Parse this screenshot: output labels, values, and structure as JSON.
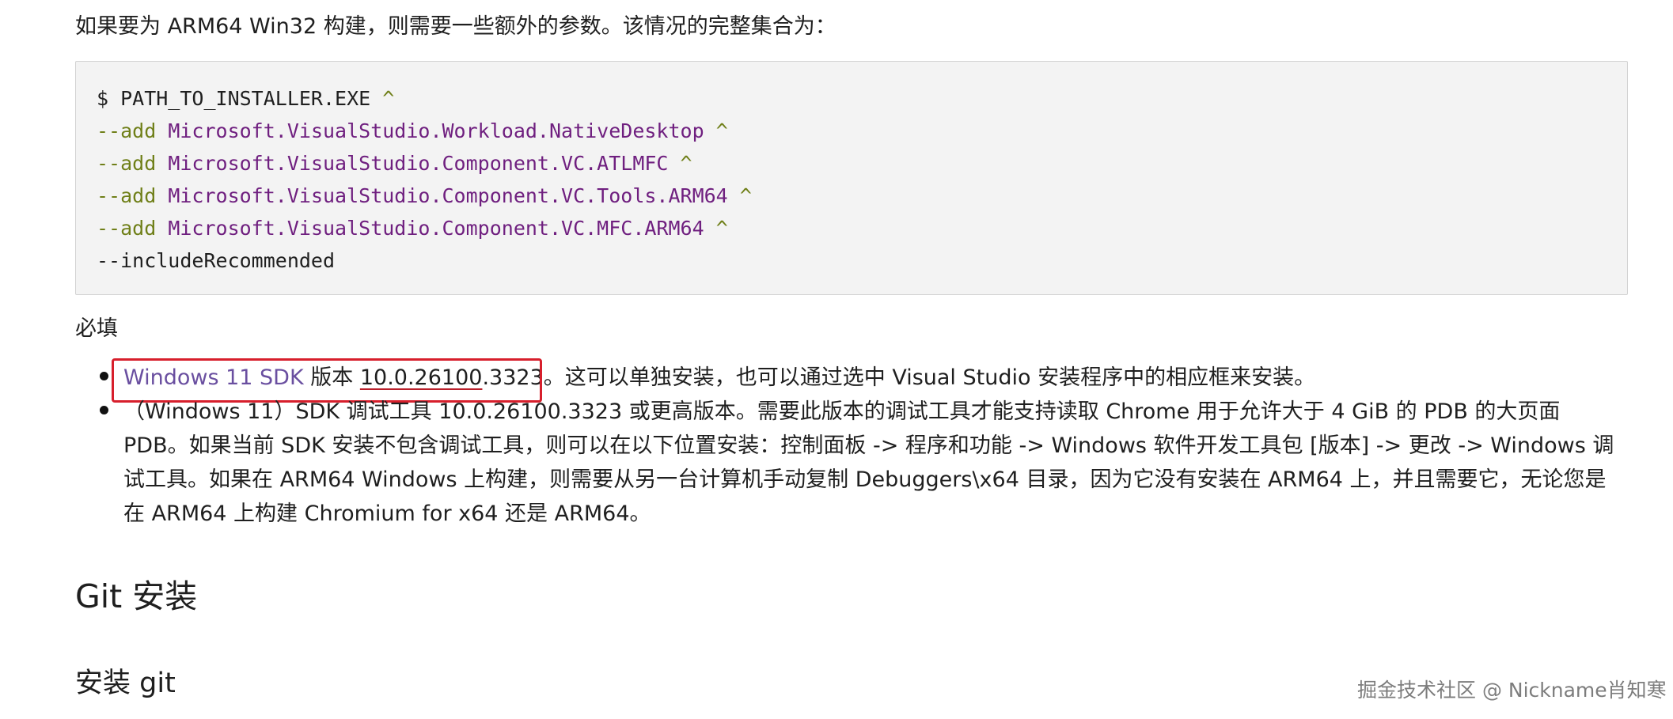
{
  "intro_text": "如果要为 ARM64 Win32 构建，则需要一些额外的参数。该情况的完整集合为：",
  "code_lines": [
    {
      "prompt": "$ PATH_TO_INSTALLER.EXE",
      "caret": "^"
    },
    {
      "flag": "--add",
      "package": "Microsoft.VisualStudio.Workload.NativeDesktop",
      "caret": "^"
    },
    {
      "flag": "--add",
      "package": "Microsoft.VisualStudio.Component.VC.ATLMFC",
      "caret": "^"
    },
    {
      "flag": "--add",
      "package": "Microsoft.VisualStudio.Component.VC.Tools.ARM64",
      "caret": "^"
    },
    {
      "flag": "--add",
      "package": "Microsoft.VisualStudio.Component.VC.MFC.ARM64",
      "caret": "^"
    },
    {
      "flag": "--includeRecommended"
    }
  ],
  "required_label": "必填",
  "requirements": {
    "item1": {
      "link_text": "Windows 11 SDK",
      "text_version_prefix": " 版本 ",
      "version_underlined": "10.0.26100",
      "version_suffix": ".3323。",
      "rest": "这可以单独安装，也可以通过选中 Visual Studio 安装程序中的相应框来安装。"
    },
    "item2": {
      "text": "（Windows 11）SDK 调试工具 10.0.26100.3323 或更高版本。需要此版本的调试工具才能支持读取 Chrome 用于允许大于 4 GiB 的 PDB 的大页面 PDB。如果当前 SDK 安装不包含调试工具，则可以在以下位置安装：控制面板 -> 程序和功能 -> Windows 软件开发工具包 [版本] -> 更改 -> Windows 调试工具。如果在 ARM64 Windows 上构建，则需要从另一台计算机手动复制 Debuggers\\x64 目录，因为它没有安装在 ARM64 上，并且需要它，无论您是在 ARM64 上构建 Chromium for x64 还是 ARM64。"
    }
  },
  "heading_git": "Git 安装",
  "heading_install_git": "安装 git",
  "watermark": "掘金技术社区 @ Nickname肖知寒",
  "colors": {
    "highlight_box": "#d71f2c",
    "link": "#6a4fa0",
    "code_background": "#f3f3f3"
  }
}
